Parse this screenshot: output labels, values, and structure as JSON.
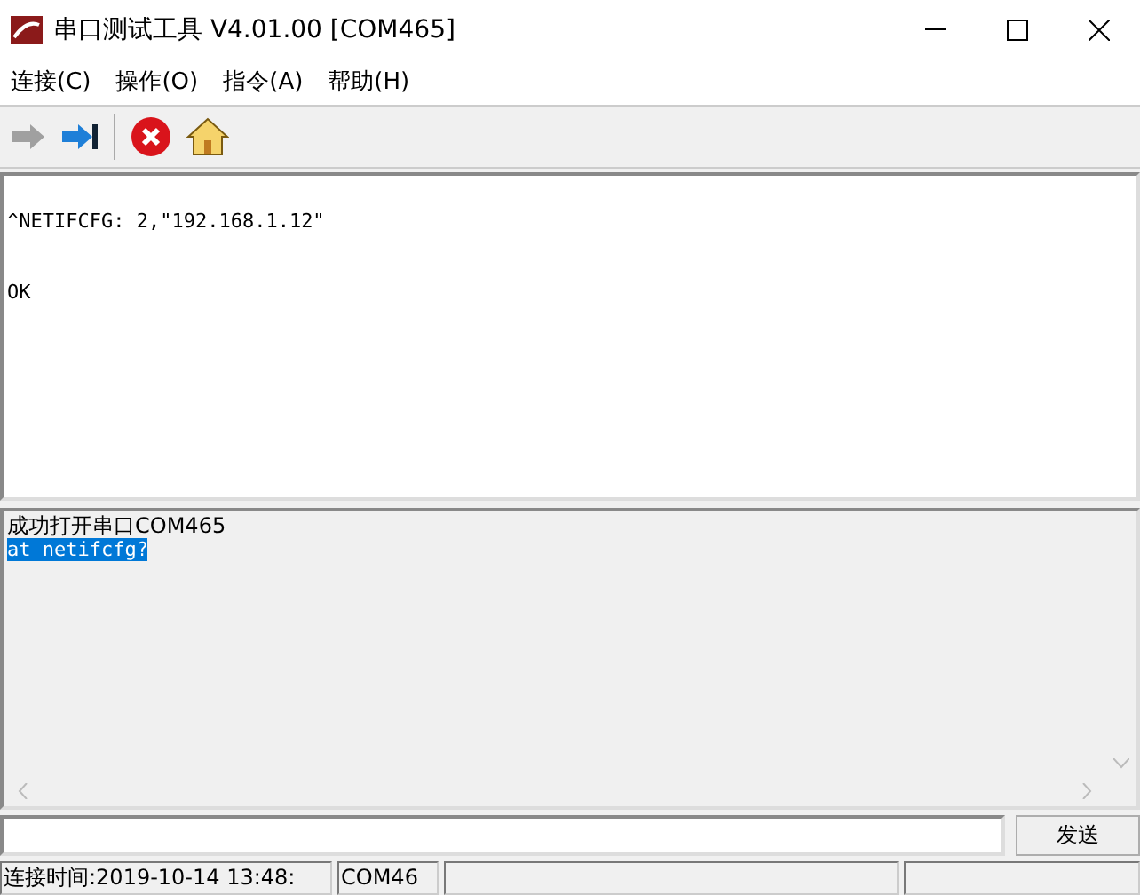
{
  "window": {
    "title": "串口测试工具 V4.01.00 [COM465]"
  },
  "menu": [
    "连接(C)",
    "操作(O)",
    "指令(A)",
    "帮助(H)"
  ],
  "toolbar": [
    {
      "kind": "arrow",
      "disabled": true
    },
    {
      "kind": "arrow-bar",
      "disabled": false
    },
    {
      "kind": "stop"
    },
    {
      "kind": "home"
    }
  ],
  "output": [
    "^NETIFCFG: 2,\"192.168.1.12\"",
    "OK"
  ],
  "log": [
    {
      "text": "成功打开串口COM465",
      "selected": false
    },
    {
      "text": "at netifcfg?",
      "selected": true
    }
  ],
  "send_button": "发送",
  "status_bar": [
    "连接时间:2019-10-14 13:48:",
    "COM46"
  ]
}
